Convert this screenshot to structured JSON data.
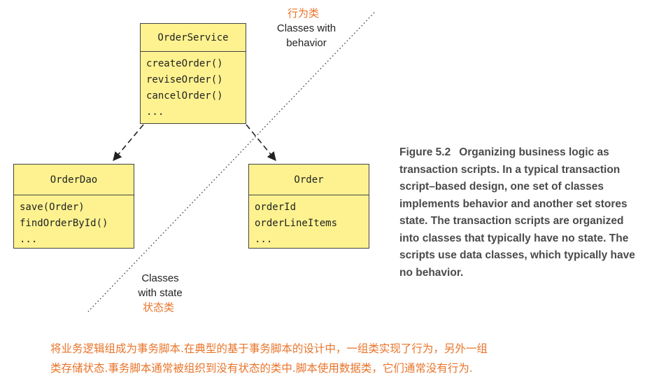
{
  "diagram": {
    "classes": [
      {
        "id": "order-service",
        "name": "OrderService",
        "members": [
          "createOrder()",
          "reviseOrder()",
          "cancelOrder()",
          "..."
        ]
      },
      {
        "id": "order-dao",
        "name": "OrderDao",
        "members": [
          "save(Order)",
          "findOrderById()",
          "..."
        ]
      },
      {
        "id": "order",
        "name": "Order",
        "members": [
          "orderId",
          "orderLineItems",
          "..."
        ]
      }
    ],
    "behavior_label": {
      "en": "Classes with behavior",
      "cn": "行为类"
    },
    "state_label": {
      "en": "Classes with state",
      "cn": "状态类"
    },
    "class_fill": "#fdf28f",
    "annotation_color": "#e8742a"
  },
  "caption": {
    "number": "Figure 5.2",
    "text": "Organizing business logic as transaction scripts. In a typical transaction script–based design, one set of classes implements behavior and another set stores state. The transaction scripts are organized into classes that typically have no state. The scripts use data classes, which typically have no behavior."
  },
  "translation": {
    "lines": [
      "将业务逻辑组成为事务脚本.在典型的基于事务脚本的设计中，一组类实现了行为，另外一组",
      "类存储状态.事务脚本通常被组织到没有状态的类中.脚本使用数据类，它们通常没有行为."
    ]
  }
}
